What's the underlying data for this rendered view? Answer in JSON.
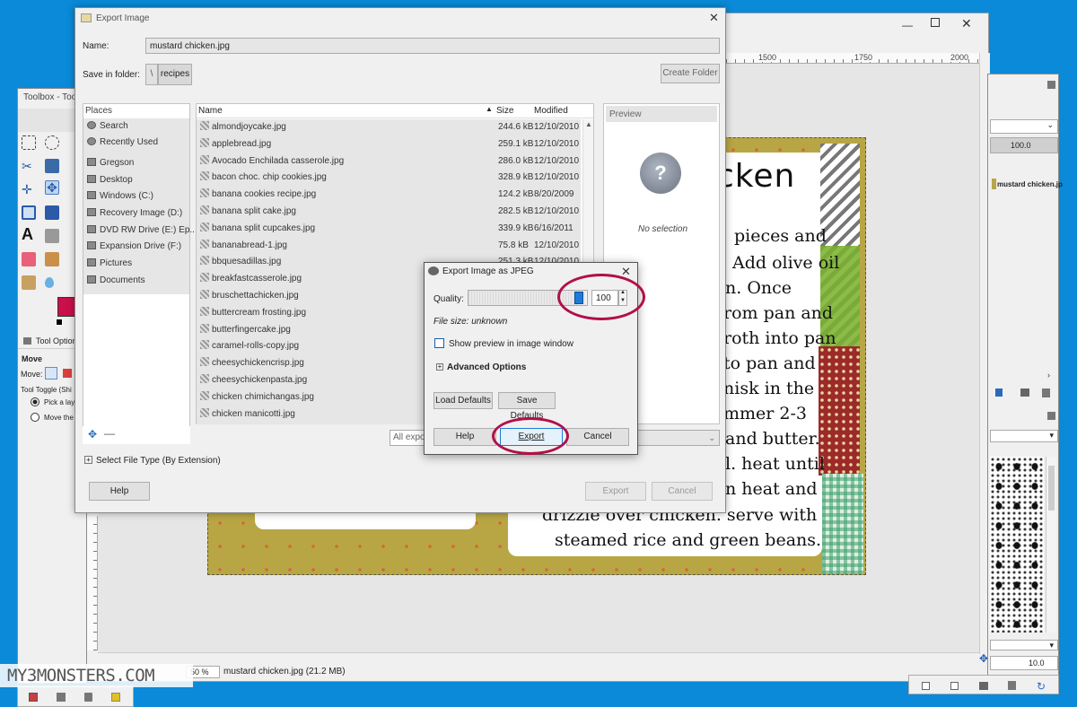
{
  "gimp_main": {
    "ruler_marks": [
      "1500",
      "1750",
      "2000"
    ],
    "status_zoom": "50 %",
    "status_file": "mustard chicken.jpg (21.2 MB)",
    "recipe_title_visible": "cken",
    "recipe_lines": [
      "pieces and",
      "Add olive oil",
      "n.  Once",
      "rom pan and",
      "roth into pan",
      "to pan and",
      "nisk in the",
      "mmer 2-3",
      "and butter.",
      "l. heat until",
      "n heat and",
      "drizzle over chicken.  serve with",
      "steamed rice and green beans."
    ]
  },
  "toolbox": {
    "title": "Toolbox - Too",
    "tool_options_label": "Tool Option",
    "move_label": "Move",
    "move_field_label": "Move:",
    "tool_toggle_label": "Tool Toggle  (Shi",
    "radio1": "Pick a laye",
    "radio2": "Move the"
  },
  "right_dock": {
    "value1": "100.0",
    "layer_name": "mustard chicken.jp",
    "value2": "10.0"
  },
  "export_image": {
    "title": "Export Image",
    "name_label": "Name:",
    "name_value": "mustard chicken.jpg",
    "save_in_label": "Save in folder:",
    "folder": "recipes",
    "create_folder": "Create Folder",
    "places_header": "Places",
    "places": [
      "Search",
      "Recently Used",
      "Gregson",
      "Desktop",
      "Windows (C:)",
      "Recovery Image (D:)",
      "DVD RW Drive (E:) Ep...",
      "Expansion Drive (F:)",
      "Pictures",
      "Documents"
    ],
    "col_name": "Name",
    "col_size": "Size",
    "col_modified": "Modified",
    "files": [
      {
        "name": "almondjoycake.jpg",
        "size": "244.6 kB",
        "modified": "12/10/2010"
      },
      {
        "name": "applebread.jpg",
        "size": "259.1 kB",
        "modified": "12/10/2010"
      },
      {
        "name": "Avocado Enchilada casserole.jpg",
        "size": "286.0 kB",
        "modified": "12/10/2010"
      },
      {
        "name": "bacon choc. chip cookies.jpg",
        "size": "328.9 kB",
        "modified": "12/10/2010"
      },
      {
        "name": "banana cookies recipe.jpg",
        "size": "124.2 kB",
        "modified": "8/20/2009"
      },
      {
        "name": "banana split cake.jpg",
        "size": "282.5 kB",
        "modified": "12/10/2010"
      },
      {
        "name": "banana split cupcakes.jpg",
        "size": "339.9 kB",
        "modified": "6/16/2011"
      },
      {
        "name": "bananabread-1.jpg",
        "size": "75.8 kB",
        "modified": "12/10/2010"
      },
      {
        "name": "bbquesadillas.jpg",
        "size": "251.3 kB",
        "modified": "12/10/2010"
      },
      {
        "name": "breakfastcasserole.jpg",
        "size": "",
        "modified": ""
      },
      {
        "name": "bruschettachicken.jpg",
        "size": "",
        "modified": ""
      },
      {
        "name": "buttercream frosting.jpg",
        "size": "",
        "modified": ""
      },
      {
        "name": "butterfingercake.jpg",
        "size": "",
        "modified": ""
      },
      {
        "name": "caramel-rolls-copy.jpg",
        "size": "",
        "modified": ""
      },
      {
        "name": "cheesychickencrisp.jpg",
        "size": "",
        "modified": ""
      },
      {
        "name": "cheesychickenpasta.jpg",
        "size": "",
        "modified": ""
      },
      {
        "name": "chicken chimichangas.jpg",
        "size": "",
        "modified": ""
      },
      {
        "name": "chicken manicotti.jpg",
        "size": "",
        "modified": ""
      }
    ],
    "preview_label": "Preview",
    "no_selection": "No selection",
    "filter_value": "All expo",
    "select_file_type": "Select File Type (By Extension)",
    "help": "Help",
    "export": "Export",
    "cancel": "Cancel"
  },
  "jpeg_dialog": {
    "title": "Export Image as JPEG",
    "quality_label": "Quality:",
    "quality_value": "100",
    "quality_fraction": 1.0,
    "file_size": "File size: unknown",
    "show_preview": "Show preview in image window",
    "advanced_options": "Advanced Options",
    "load_defaults": "Load Defaults",
    "save_defaults": "Save Defaults",
    "help": "Help",
    "export": "Export",
    "cancel": "Cancel"
  },
  "watermark": "MY3MONSTERS.COM",
  "colors": {
    "desktop": "#0a8ad8",
    "highlight_ring": "#b0104a",
    "fg_color": "#c8104a",
    "olive": "#b8a644"
  }
}
